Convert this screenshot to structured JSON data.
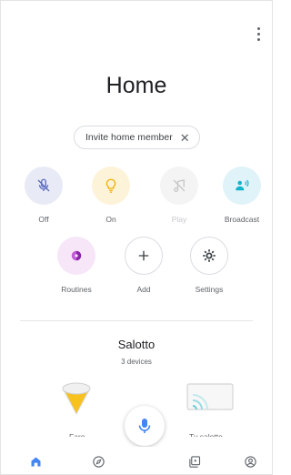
{
  "header": {
    "title": "Home",
    "menu_icon": "more-vert-icon"
  },
  "invite": {
    "label": "Invite home member",
    "close_icon": "close-icon"
  },
  "actions": [
    {
      "label": "Off",
      "icon": "mic-off-icon",
      "color": "#e8eaf6"
    },
    {
      "label": "On",
      "icon": "lightbulb-icon",
      "color": "#fdf3d9"
    },
    {
      "label": "Play",
      "icon": "music-off-icon",
      "color": "#f4f4f4"
    },
    {
      "label": "Broadcast",
      "icon": "broadcast-icon",
      "color": "#e0f3f8"
    },
    {
      "label": "Routines",
      "icon": "routines-icon",
      "color": "#f6e6f8"
    },
    {
      "label": "Add",
      "icon": "plus-icon"
    },
    {
      "label": "Settings",
      "icon": "gear-icon"
    }
  ],
  "room": {
    "name": "Salotto",
    "device_count": "3 devices",
    "devices": [
      {
        "label": "Faro",
        "icon": "lamp-icon"
      },
      {
        "label": "Tv salotto",
        "icon": "cast-tv-icon"
      }
    ]
  },
  "assistant": {
    "icon": "mic-icon",
    "accent": "#4285f4"
  },
  "nav": [
    {
      "name": "home",
      "icon": "home-icon",
      "active": true
    },
    {
      "name": "discover",
      "icon": "compass-icon"
    },
    {
      "name": "media",
      "icon": "media-icon"
    },
    {
      "name": "account",
      "icon": "account-icon"
    }
  ]
}
